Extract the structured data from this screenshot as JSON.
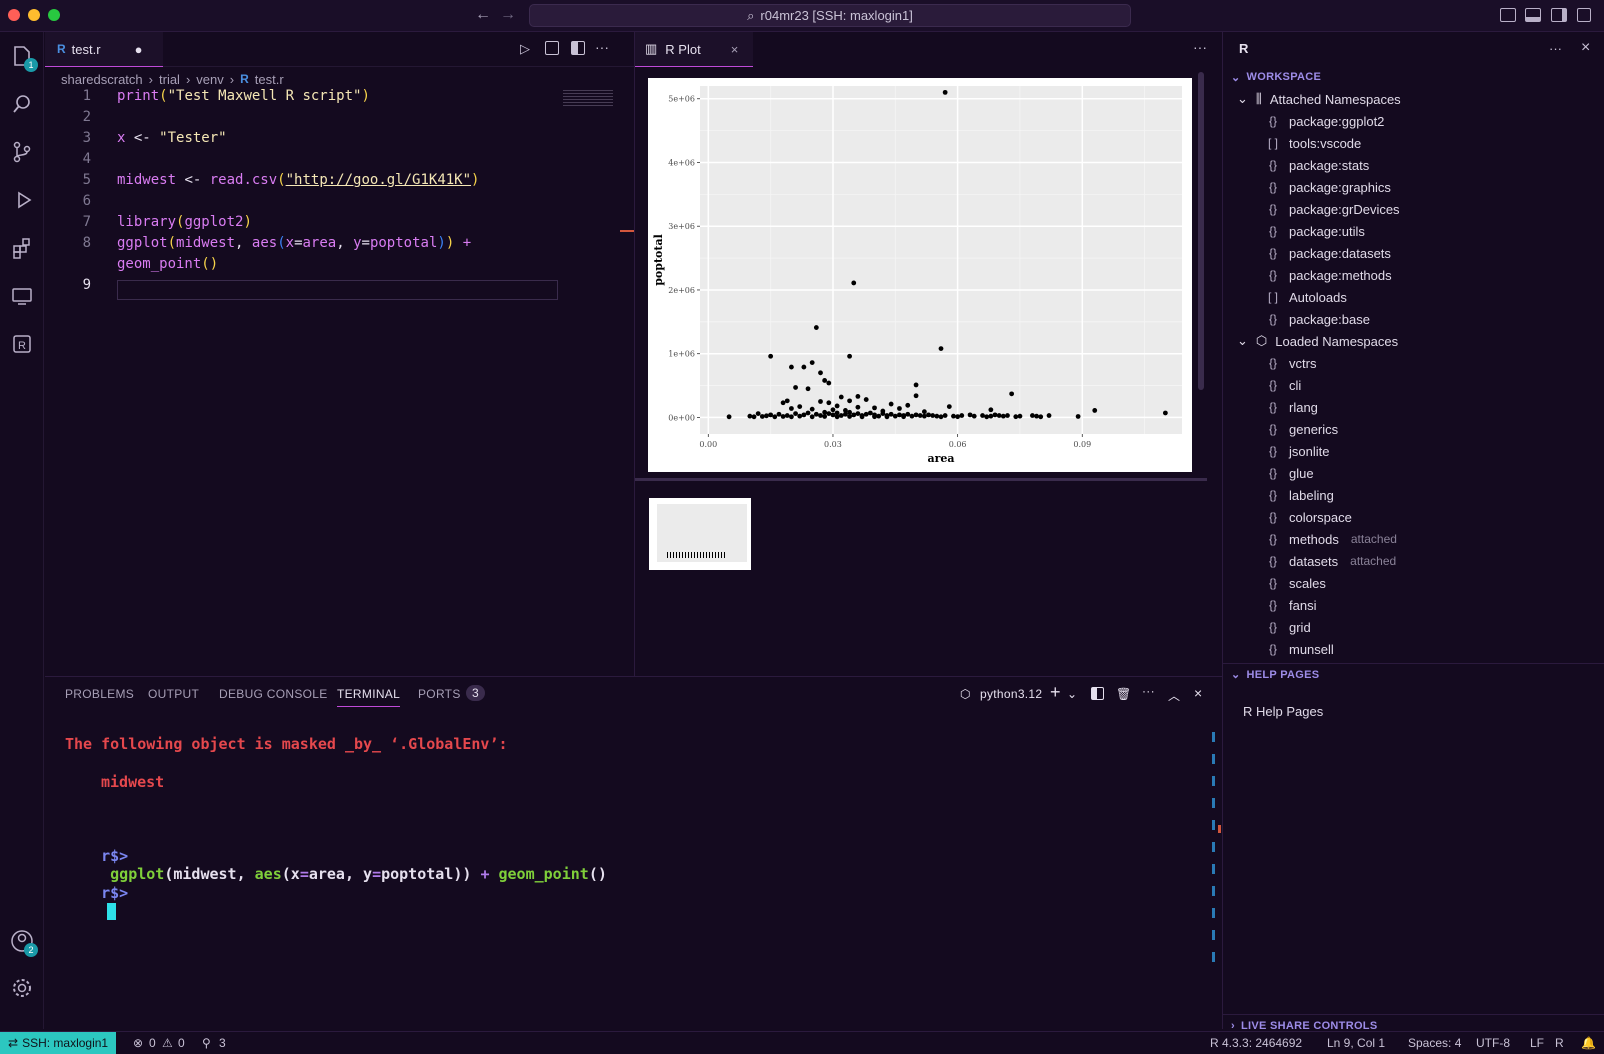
{
  "window": {
    "command_center": "r04mr23 [SSH: maxlogin1]"
  },
  "activity": {
    "explorer_badge": "1",
    "accounts_badge": "2"
  },
  "editor": {
    "tab_label": "test.r",
    "breadcrumb": [
      "sharedscratch",
      "trial",
      "venv",
      "test.r"
    ],
    "line_numbers": [
      "1",
      "2",
      "3",
      "4",
      "5",
      "6",
      "7",
      "8",
      "",
      "9"
    ],
    "lines": [
      [
        {
          "t": "print",
          "c": "k"
        },
        {
          "t": "(",
          "c": "p"
        },
        {
          "t": "\"Test Maxwell R script\"",
          "c": "s"
        },
        {
          "t": ")",
          "c": "p"
        }
      ],
      [],
      [
        {
          "t": "x",
          "c": "k"
        },
        {
          "t": " <- ",
          "c": ""
        },
        {
          "t": "\"Tester\"",
          "c": "s"
        }
      ],
      [],
      [
        {
          "t": "midwest",
          "c": "k"
        },
        {
          "t": " <- ",
          "c": ""
        },
        {
          "t": "read.csv",
          "c": "k"
        },
        {
          "t": "(",
          "c": "p"
        },
        {
          "t": "\"http://goo.gl/G1K41K\"",
          "c": "s"
        },
        {
          "t": ")",
          "c": "p"
        }
      ],
      [],
      [
        {
          "t": "library",
          "c": "k"
        },
        {
          "t": "(",
          "c": "p"
        },
        {
          "t": "ggplot2",
          "c": "k"
        },
        {
          "t": ")",
          "c": "p"
        }
      ],
      [
        {
          "t": "ggplot",
          "c": "k"
        },
        {
          "t": "(",
          "c": "p"
        },
        {
          "t": "midwest",
          "c": "k"
        },
        {
          "t": ", ",
          "c": ""
        },
        {
          "t": "aes",
          "c": "k"
        },
        {
          "t": "(",
          "c": "a"
        },
        {
          "t": "x",
          "c": "k"
        },
        {
          "t": "=",
          "c": ""
        },
        {
          "t": "area",
          "c": "k"
        },
        {
          "t": ", ",
          "c": ""
        },
        {
          "t": "y",
          "c": "k"
        },
        {
          "t": "=",
          "c": ""
        },
        {
          "t": "poptotal",
          "c": "k"
        },
        {
          "t": ")",
          "c": "a"
        },
        {
          "t": ")",
          "c": "p"
        },
        {
          "t": " +",
          "c": "k"
        }
      ],
      [
        {
          "t": "geom_point",
          "c": "k"
        },
        {
          "t": "()",
          "c": "p"
        }
      ],
      []
    ]
  },
  "plot_tab": {
    "label": "R Plot"
  },
  "chart_data": {
    "type": "scatter",
    "title": "",
    "xlabel": "area",
    "ylabel": "poptotal",
    "xlim": [
      -0.002,
      0.114
    ],
    "ylim": [
      -260000.0,
      5200000.0
    ],
    "x_ticks": [
      0.0,
      0.03,
      0.06,
      0.09
    ],
    "x_tick_labels": [
      "0.00",
      "0.03",
      "0.06",
      "0.09"
    ],
    "y_ticks": [
      0,
      1000000,
      2000000,
      3000000,
      4000000,
      5000000
    ],
    "y_tick_labels": [
      "0e+00",
      "1e+06",
      "2e+06",
      "3e+06",
      "4e+06",
      "5e+06"
    ],
    "grid": true,
    "points": [
      [
        0.057,
        5100000
      ],
      [
        0.035,
        2110000
      ],
      [
        0.026,
        1410000
      ],
      [
        0.056,
        1080000
      ],
      [
        0.015,
        960000
      ],
      [
        0.034,
        960000
      ],
      [
        0.025,
        860000
      ],
      [
        0.023,
        790000
      ],
      [
        0.02,
        790000
      ],
      [
        0.027,
        700000
      ],
      [
        0.028,
        580000
      ],
      [
        0.029,
        540000
      ],
      [
        0.021,
        470000
      ],
      [
        0.024,
        450000
      ],
      [
        0.05,
        510000
      ],
      [
        0.073,
        370000
      ],
      [
        0.032,
        320000
      ],
      [
        0.05,
        340000
      ],
      [
        0.036,
        330000
      ],
      [
        0.019,
        260000
      ],
      [
        0.018,
        230000
      ],
      [
        0.027,
        250000
      ],
      [
        0.029,
        230000
      ],
      [
        0.034,
        260000
      ],
      [
        0.038,
        280000
      ],
      [
        0.044,
        210000
      ],
      [
        0.048,
        190000
      ],
      [
        0.058,
        170000
      ],
      [
        0.022,
        170000
      ],
      [
        0.031,
        180000
      ],
      [
        0.036,
        160000
      ],
      [
        0.04,
        150000
      ],
      [
        0.046,
        140000
      ],
      [
        0.093,
        110000
      ],
      [
        0.068,
        120000
      ],
      [
        0.02,
        140000
      ],
      [
        0.025,
        130000
      ],
      [
        0.03,
        120000
      ],
      [
        0.033,
        110000
      ],
      [
        0.042,
        100000
      ],
      [
        0.052,
        90000
      ],
      [
        0.11,
        70000
      ],
      [
        0.012,
        60000
      ],
      [
        0.015,
        40000
      ],
      [
        0.017,
        50000
      ],
      [
        0.019,
        30000
      ],
      [
        0.021,
        60000
      ],
      [
        0.023,
        40000
      ],
      [
        0.024,
        70000
      ],
      [
        0.026,
        50000
      ],
      [
        0.027,
        30000
      ],
      [
        0.028,
        80000
      ],
      [
        0.029,
        60000
      ],
      [
        0.03,
        40000
      ],
      [
        0.031,
        70000
      ],
      [
        0.032,
        30000
      ],
      [
        0.033,
        50000
      ],
      [
        0.034,
        80000
      ],
      [
        0.035,
        40000
      ],
      [
        0.036,
        60000
      ],
      [
        0.037,
        30000
      ],
      [
        0.038,
        50000
      ],
      [
        0.039,
        70000
      ],
      [
        0.04,
        40000
      ],
      [
        0.041,
        20000
      ],
      [
        0.042,
        60000
      ],
      [
        0.043,
        30000
      ],
      [
        0.044,
        50000
      ],
      [
        0.045,
        20000
      ],
      [
        0.046,
        40000
      ],
      [
        0.047,
        30000
      ],
      [
        0.048,
        50000
      ],
      [
        0.049,
        20000
      ],
      [
        0.05,
        40000
      ],
      [
        0.051,
        30000
      ],
      [
        0.052,
        20000
      ],
      [
        0.053,
        40000
      ],
      [
        0.054,
        30000
      ],
      [
        0.055,
        20000
      ],
      [
        0.057,
        30000
      ],
      [
        0.059,
        20000
      ],
      [
        0.061,
        30000
      ],
      [
        0.063,
        40000
      ],
      [
        0.064,
        20000
      ],
      [
        0.066,
        30000
      ],
      [
        0.068,
        20000
      ],
      [
        0.069,
        40000
      ],
      [
        0.07,
        30000
      ],
      [
        0.071,
        20000
      ],
      [
        0.072,
        30000
      ],
      [
        0.075,
        20000
      ],
      [
        0.078,
        30000
      ],
      [
        0.079,
        20000
      ],
      [
        0.082,
        30000
      ],
      [
        0.089,
        15000
      ],
      [
        0.005,
        10000
      ],
      [
        0.01,
        20000
      ],
      [
        0.011,
        10000
      ],
      [
        0.013,
        15000
      ],
      [
        0.014,
        25000
      ],
      [
        0.016,
        10000
      ],
      [
        0.018,
        15000
      ],
      [
        0.02,
        10000
      ],
      [
        0.022,
        20000
      ],
      [
        0.025,
        10000
      ],
      [
        0.028,
        15000
      ],
      [
        0.031,
        10000
      ],
      [
        0.034,
        15000
      ],
      [
        0.037,
        10000
      ],
      [
        0.04,
        12000
      ],
      [
        0.043,
        10000
      ],
      [
        0.047,
        12000
      ],
      [
        0.056,
        10000
      ],
      [
        0.06,
        12000
      ],
      [
        0.067,
        10000
      ],
      [
        0.074,
        12000
      ],
      [
        0.08,
        10000
      ]
    ]
  },
  "workspace": {
    "title": "WORKSPACE",
    "attached_label": "Attached Namespaces",
    "attached": [
      {
        "icon": "{}",
        "name": "package:ggplot2"
      },
      {
        "icon": "[ ]",
        "name": "tools:vscode"
      },
      {
        "icon": "{}",
        "name": "package:stats"
      },
      {
        "icon": "{}",
        "name": "package:graphics"
      },
      {
        "icon": "{}",
        "name": "package:grDevices"
      },
      {
        "icon": "{}",
        "name": "package:utils"
      },
      {
        "icon": "{}",
        "name": "package:datasets"
      },
      {
        "icon": "{}",
        "name": "package:methods"
      },
      {
        "icon": "[ ]",
        "name": "Autoloads"
      },
      {
        "icon": "{}",
        "name": "package:base"
      }
    ],
    "loaded_label": "Loaded Namespaces",
    "loaded": [
      {
        "name": "vctrs",
        "note": ""
      },
      {
        "name": "cli",
        "note": ""
      },
      {
        "name": "rlang",
        "note": ""
      },
      {
        "name": "generics",
        "note": ""
      },
      {
        "name": "jsonlite",
        "note": ""
      },
      {
        "name": "glue",
        "note": ""
      },
      {
        "name": "labeling",
        "note": ""
      },
      {
        "name": "colorspace",
        "note": ""
      },
      {
        "name": "methods",
        "note": "attached"
      },
      {
        "name": "datasets",
        "note": "attached"
      },
      {
        "name": "scales",
        "note": ""
      },
      {
        "name": "fansi",
        "note": ""
      },
      {
        "name": "grid",
        "note": ""
      },
      {
        "name": "munsell",
        "note": ""
      }
    ],
    "help_title": "HELP PAGES",
    "help_item": "R Help Pages",
    "live_share": "LIVE SHARE CONTROLS"
  },
  "panel": {
    "tabs": [
      "PROBLEMS",
      "OUTPUT",
      "DEBUG CONSOLE",
      "TERMINAL",
      "PORTS"
    ],
    "ports_count": "3",
    "shell_label": "python3.12"
  },
  "terminal": {
    "line1": "The following object is masked _by_ ‘.GlobalEnv’:",
    "line2": "midwest",
    "prompt": "r$>",
    "cmd_parts": [
      {
        "t": "ggplot",
        "c": "g"
      },
      {
        "t": "(midwest, ",
        "c": "w"
      },
      {
        "t": "aes",
        "c": "g"
      },
      {
        "t": "(x",
        "c": "w"
      },
      {
        "t": "=",
        "c": "o"
      },
      {
        "t": "area, y",
        "c": "w"
      },
      {
        "t": "=",
        "c": "o"
      },
      {
        "t": "poptotal)) ",
        "c": "w"
      },
      {
        "t": "+",
        "c": "o"
      },
      {
        "t": " ",
        "c": "w"
      },
      {
        "t": "geom_point",
        "c": "g"
      },
      {
        "t": "()",
        "c": "w"
      }
    ]
  },
  "status": {
    "ssh": "SSH: maxlogin1",
    "errors": "0",
    "warnings": "0",
    "ports": "3",
    "r_version": "R 4.3.3: 2464692",
    "position": "Ln 9, Col 1",
    "spaces": "Spaces: 4",
    "encoding": "UTF-8",
    "eol": "LF",
    "language": "R"
  }
}
